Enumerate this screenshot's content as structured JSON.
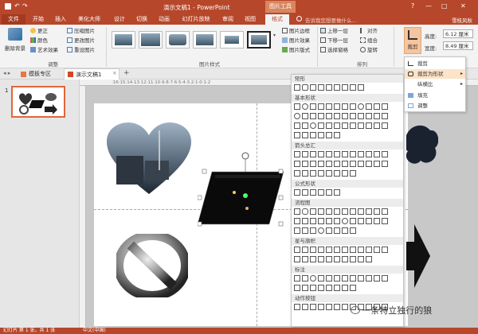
{
  "titlebar": {
    "doc_title": "演示文稿1 - PowerPoint",
    "tool_context": "图片工具",
    "window_controls": [
      "?",
      "—",
      "□",
      "✕"
    ]
  },
  "tabs": {
    "file": "文件",
    "items": [
      "开始",
      "插入",
      "美化大师",
      "设计",
      "切换",
      "动画",
      "幻灯片放映",
      "审阅",
      "视图",
      "格式"
    ],
    "active": "格式",
    "search_placeholder": "告诉我您想要做什么...",
    "user": "雪枝风秋"
  },
  "ribbon": {
    "remove_bg": "删除背景",
    "adjust_items": [
      "更正",
      "颜色",
      "艺术效果"
    ],
    "adjust_items2": [
      "压缩图片",
      "更改图片",
      "重设图片"
    ],
    "group_adjust": "调整",
    "group_styles": "图片样式",
    "style_items": [
      "图片边框",
      "图片效果",
      "图片版式"
    ],
    "arrange_items": [
      "上移一层",
      "下移一层",
      "选择窗格"
    ],
    "arrange_items2": [
      "对齐",
      "组合",
      "旋转"
    ],
    "group_arrange": "排列",
    "crop": "裁剪",
    "height_label": "高度:",
    "height_value": "6.12 厘米",
    "width_label": "宽度:",
    "width_value": "8.49 厘米"
  },
  "doc_tabs": {
    "template": "模板专区",
    "current": "演示文稿1",
    "add": "+"
  },
  "thumbnails": {
    "slide_number": "1"
  },
  "ruler_text": "·16·15·14·13·12·11·10·9·8·7·6·5·4·3·2·1·0·1·2",
  "shapes_menu": {
    "sections": [
      "矩形",
      "基本形状",
      "箭头总汇",
      "公式形状",
      "流程图",
      "星与旗帜",
      "标注",
      "动作按钮"
    ]
  },
  "crop_menu": {
    "items": [
      "裁剪",
      "裁剪为形状",
      "纵横比",
      "填充",
      "调整"
    ],
    "highlighted": "裁剪为形状"
  },
  "status": {
    "slide_info": "幻灯片 第 1 张，共 1 张",
    "language": "中文(中国)"
  },
  "watermark": "一条特立独行的狼",
  "colors": {
    "accent": "#b7472a",
    "ribbon_bg": "#f3f3f3",
    "highlight": "#fde3c8"
  }
}
